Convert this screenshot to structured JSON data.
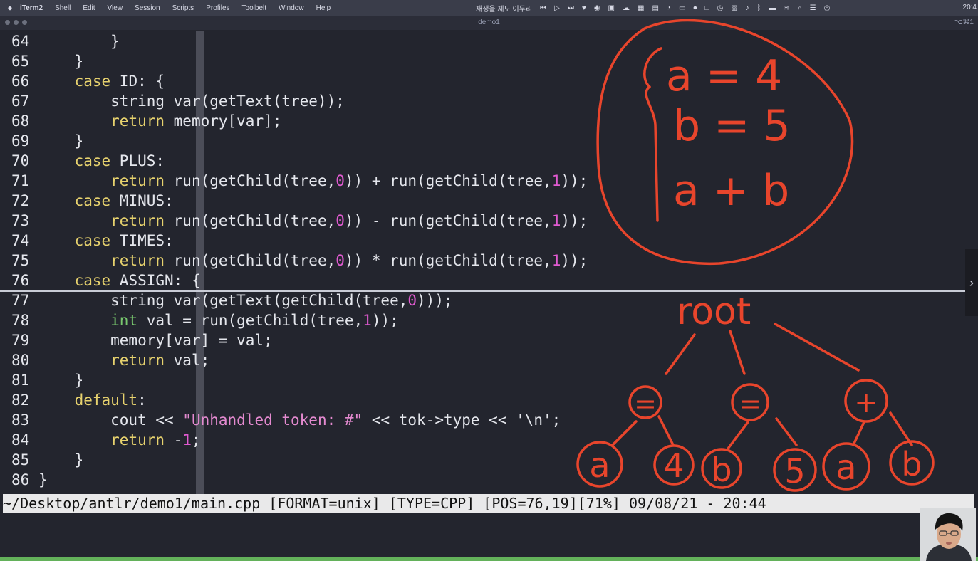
{
  "menubar": {
    "apple_icon": "apple-icon",
    "items": [
      "iTerm2",
      "Shell",
      "Edit",
      "View",
      "Session",
      "Scripts",
      "Profiles",
      "Toolbelt",
      "Window",
      "Help"
    ],
    "status_text": "재생을 제도 이두리",
    "clock": "20:4"
  },
  "window": {
    "title": "demo1",
    "shortcut": "⌥⌘1"
  },
  "editor": {
    "lines": [
      {
        "n": "64",
        "segs": [
          {
            "t": "        }",
            "c": ""
          }
        ]
      },
      {
        "n": "65",
        "segs": [
          {
            "t": "    }",
            "c": ""
          }
        ]
      },
      {
        "n": "66",
        "segs": [
          {
            "t": "    ",
            "c": ""
          },
          {
            "t": "case",
            "c": "kw"
          },
          {
            "t": " ID: {",
            "c": ""
          }
        ]
      },
      {
        "n": "67",
        "segs": [
          {
            "t": "        string var(getText(tree));",
            "c": ""
          }
        ]
      },
      {
        "n": "68",
        "segs": [
          {
            "t": "        ",
            "c": ""
          },
          {
            "t": "return",
            "c": "kw"
          },
          {
            "t": " memory[var];",
            "c": ""
          }
        ]
      },
      {
        "n": "69",
        "segs": [
          {
            "t": "    }",
            "c": ""
          }
        ]
      },
      {
        "n": "70",
        "segs": [
          {
            "t": "    ",
            "c": ""
          },
          {
            "t": "case",
            "c": "kw"
          },
          {
            "t": " PLUS:",
            "c": ""
          }
        ]
      },
      {
        "n": "71",
        "segs": [
          {
            "t": "        ",
            "c": ""
          },
          {
            "t": "return",
            "c": "kw"
          },
          {
            "t": " run(getChild(tree,",
            "c": ""
          },
          {
            "t": "0",
            "c": "num"
          },
          {
            "t": ")) + run(getChild(tree,",
            "c": ""
          },
          {
            "t": "1",
            "c": "num"
          },
          {
            "t": "));",
            "c": ""
          }
        ]
      },
      {
        "n": "72",
        "segs": [
          {
            "t": "    ",
            "c": ""
          },
          {
            "t": "case",
            "c": "kw"
          },
          {
            "t": " MINUS:",
            "c": ""
          }
        ]
      },
      {
        "n": "73",
        "segs": [
          {
            "t": "        ",
            "c": ""
          },
          {
            "t": "return",
            "c": "kw"
          },
          {
            "t": " run(getChild(tree,",
            "c": ""
          },
          {
            "t": "0",
            "c": "num"
          },
          {
            "t": ")) - run(getChild(tree,",
            "c": ""
          },
          {
            "t": "1",
            "c": "num"
          },
          {
            "t": "));",
            "c": ""
          }
        ]
      },
      {
        "n": "74",
        "segs": [
          {
            "t": "    ",
            "c": ""
          },
          {
            "t": "case",
            "c": "kw"
          },
          {
            "t": " TIMES:",
            "c": ""
          }
        ]
      },
      {
        "n": "75",
        "segs": [
          {
            "t": "        ",
            "c": ""
          },
          {
            "t": "return",
            "c": "kw"
          },
          {
            "t": " run(getChild(tree,",
            "c": ""
          },
          {
            "t": "0",
            "c": "num"
          },
          {
            "t": ")) * run(getChild(tree,",
            "c": ""
          },
          {
            "t": "1",
            "c": "num"
          },
          {
            "t": "));",
            "c": ""
          }
        ]
      },
      {
        "n": "76",
        "segs": [
          {
            "t": "    ",
            "c": ""
          },
          {
            "t": "case",
            "c": "kw"
          },
          {
            "t": " ASSIGN: {",
            "c": ""
          }
        ]
      },
      {
        "n": "77",
        "segs": [
          {
            "t": "        string var(getText(getChild(tree,",
            "c": ""
          },
          {
            "t": "0",
            "c": "num"
          },
          {
            "t": ")));",
            "c": ""
          }
        ]
      },
      {
        "n": "78",
        "segs": [
          {
            "t": "        ",
            "c": ""
          },
          {
            "t": "int",
            "c": "ty"
          },
          {
            "t": " val = run(getChild(tree,",
            "c": ""
          },
          {
            "t": "1",
            "c": "num"
          },
          {
            "t": "));",
            "c": ""
          }
        ]
      },
      {
        "n": "79",
        "segs": [
          {
            "t": "        memory[var] = val;",
            "c": ""
          }
        ]
      },
      {
        "n": "80",
        "segs": [
          {
            "t": "        ",
            "c": ""
          },
          {
            "t": "return",
            "c": "kw"
          },
          {
            "t": " val;",
            "c": ""
          }
        ]
      },
      {
        "n": "81",
        "segs": [
          {
            "t": "    }",
            "c": ""
          }
        ]
      },
      {
        "n": "82",
        "segs": [
          {
            "t": "    ",
            "c": ""
          },
          {
            "t": "default",
            "c": "kw"
          },
          {
            "t": ":",
            "c": ""
          }
        ]
      },
      {
        "n": "83",
        "segs": [
          {
            "t": "        cout << ",
            "c": ""
          },
          {
            "t": "\"Unhandled token: #\"",
            "c": "str"
          },
          {
            "t": " << tok->type << '\\n';",
            "c": ""
          }
        ]
      },
      {
        "n": "84",
        "segs": [
          {
            "t": "        ",
            "c": ""
          },
          {
            "t": "return",
            "c": "kw"
          },
          {
            "t": " -",
            "c": ""
          },
          {
            "t": "1",
            "c": "num"
          },
          {
            "t": ";",
            "c": ""
          }
        ]
      },
      {
        "n": "85",
        "segs": [
          {
            "t": "    }",
            "c": ""
          }
        ]
      },
      {
        "n": "86",
        "segs": [
          {
            "t": "}",
            "c": ""
          }
        ]
      }
    ]
  },
  "statusline": {
    "text": "~/Desktop/antlr/demo1/main.cpp [FORMAT=unix] [TYPE=CPP] [POS=76,19][71%] 09/08/21 - 20:44"
  },
  "annotations": {
    "stmt_1": "a = 4",
    "stmt_2": "b = 5",
    "stmt_3": "a + b",
    "tree_root": "root",
    "tree_nodes": [
      "=",
      "=",
      "+"
    ],
    "tree_leaves": [
      "a",
      "4",
      "b",
      "5",
      "a",
      "b"
    ]
  },
  "colors": {
    "background": "#23252e",
    "keyword": "#e7d26e",
    "type": "#78c86e",
    "number": "#e05ad0",
    "ink": "#e8452c"
  }
}
